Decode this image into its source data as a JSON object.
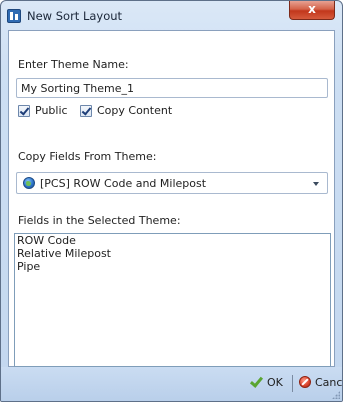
{
  "window": {
    "title": "New Sort Layout",
    "close_glyph": "x"
  },
  "form": {
    "theme_name_label": "Enter Theme Name:",
    "theme_name_value": "My Sorting Theme_1",
    "public_label": "Public",
    "public_checked": true,
    "copy_content_label": "Copy Content",
    "copy_content_checked": true,
    "copy_fields_label": "Copy Fields From Theme:",
    "copy_fields_selected": "[PCS] ROW Code and Milepost",
    "copy_fields_icon": "globe-icon",
    "fields_label": "Fields in the Selected Theme:",
    "fields": [
      "ROW Code",
      "Relative Milepost",
      "Pipe"
    ]
  },
  "footer": {
    "ok_label": "OK",
    "ok_icon": "checkmark-icon",
    "cancel_label": "Cancel",
    "cancel_icon": "cancel-icon"
  },
  "colors": {
    "accent_ok": "#5aa531",
    "accent_cancel": "#d9412a",
    "frame": "#c3d7ef"
  }
}
